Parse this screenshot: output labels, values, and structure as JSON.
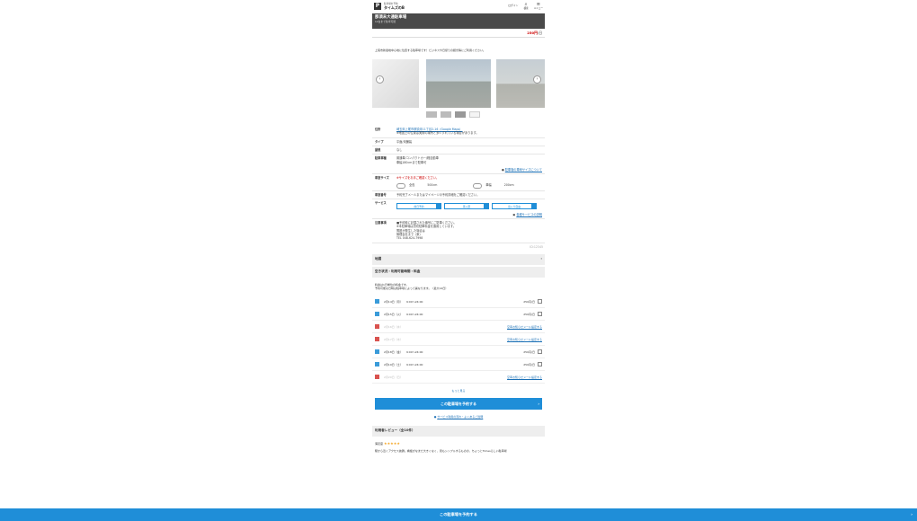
{
  "header": {
    "logo_small": "駐車場を予約",
    "logo_big": "タイムズのB",
    "login": "ログイン",
    "search_label": "検索",
    "menu_label": "メニュー"
  },
  "parking": {
    "name": "那須未大通駐車場",
    "subtitle": "12台まで駐車可能",
    "price": "250円",
    "price_unit": "/日",
    "description": "上尾市新宿地中心地に位置する駐車場です！ビジネスや日帰りの観光等にご利用ください。"
  },
  "info": {
    "address_label": "住所",
    "address": "埼玉県上尾市那須未11丁目2-16（Google Maps）",
    "address_note": "※地図上の位置は実際の場所と多少ずれている場合があります。",
    "type_label": "タイプ",
    "type": "平面/未舗装",
    "roof_label": "屋根",
    "roof": "なし",
    "car_label": "駐車車種",
    "car_value1": "普通車/コンパクトカー/軽自動車",
    "car_value2": "車幅180cmまで駐車可",
    "car_link": "駐車場の車両サイズについて",
    "size_label": "車室サイズ",
    "size_note": "※サイズをお手ご確認ください。",
    "size_len_label": "全長",
    "size_len": "500cm",
    "size_wid_label": "車幅",
    "size_wid": "200cm",
    "num_label": "車室番号",
    "num": "予約完了メールまたはマイページの予約詳細をご確認ください。",
    "svc_label": "サービス",
    "svc": [
      "前日予約",
      "再入庫",
      "出入り自由"
    ],
    "svc_link": "各種サービスの説明",
    "notes_label": "注意事項",
    "notes": [
      "■予約時に記載された番号にご駐車ください。",
      "※本駐車場は貸切駐車料金を適用しています。",
      "問題が発生した場合は",
      "管理会社まで（東）",
      "TEL 048-624-7998"
    ],
    "code": "ID:12345"
  },
  "map_section": "地図",
  "availability": {
    "title": "空き状況・利用可能時間・料金",
    "note1": "料金は1日単位の料金です。",
    "note2": "予約可能な日時は駐車場によって異なります。（最大14日）",
    "rows": [
      {
        "date": "2月14日（月）",
        "time": "9:00〜24:00",
        "price": "250円/日",
        "avail": true
      },
      {
        "date": "2月15日（火）",
        "time": "9:00〜24:00",
        "price": "250円/日",
        "avail": true
      },
      {
        "date": "2月16日（水）",
        "time": "",
        "price": "空車お知らせメール設定する",
        "avail": false
      },
      {
        "date": "2月17日（木）",
        "time": "",
        "price": "空車お知らせメール設定する",
        "avail": false
      },
      {
        "date": "2月18日（金）",
        "time": "9:00〜24:00",
        "price": "250円/日",
        "avail": true
      },
      {
        "date": "2月19日（土）",
        "time": "9:00〜24:00",
        "price": "250円/日",
        "avail": true
      },
      {
        "date": "2月20日（日）",
        "time": "",
        "price": "空車お知らせメール設定する",
        "avail": false
      }
    ],
    "more": "もっと見る",
    "book_button": "この駐車場を予約する",
    "help_link": "サービス利用の流れ・よくあるご質問"
  },
  "reviews": {
    "title": "利用者レビュー（全10件）",
    "score_label": "満足度",
    "stars": "★★★★★",
    "text": "駅から近くアクセス抜群。看板がなまだ大きくなく、見もシンプルするものの、ちょっとTimesらしい駐車場"
  },
  "bottom_bar": "この駐車場を予約する",
  "colors": {
    "accent": "#1f8ed8",
    "available": "#3a9bd9",
    "unavailable": "#d9534f"
  }
}
